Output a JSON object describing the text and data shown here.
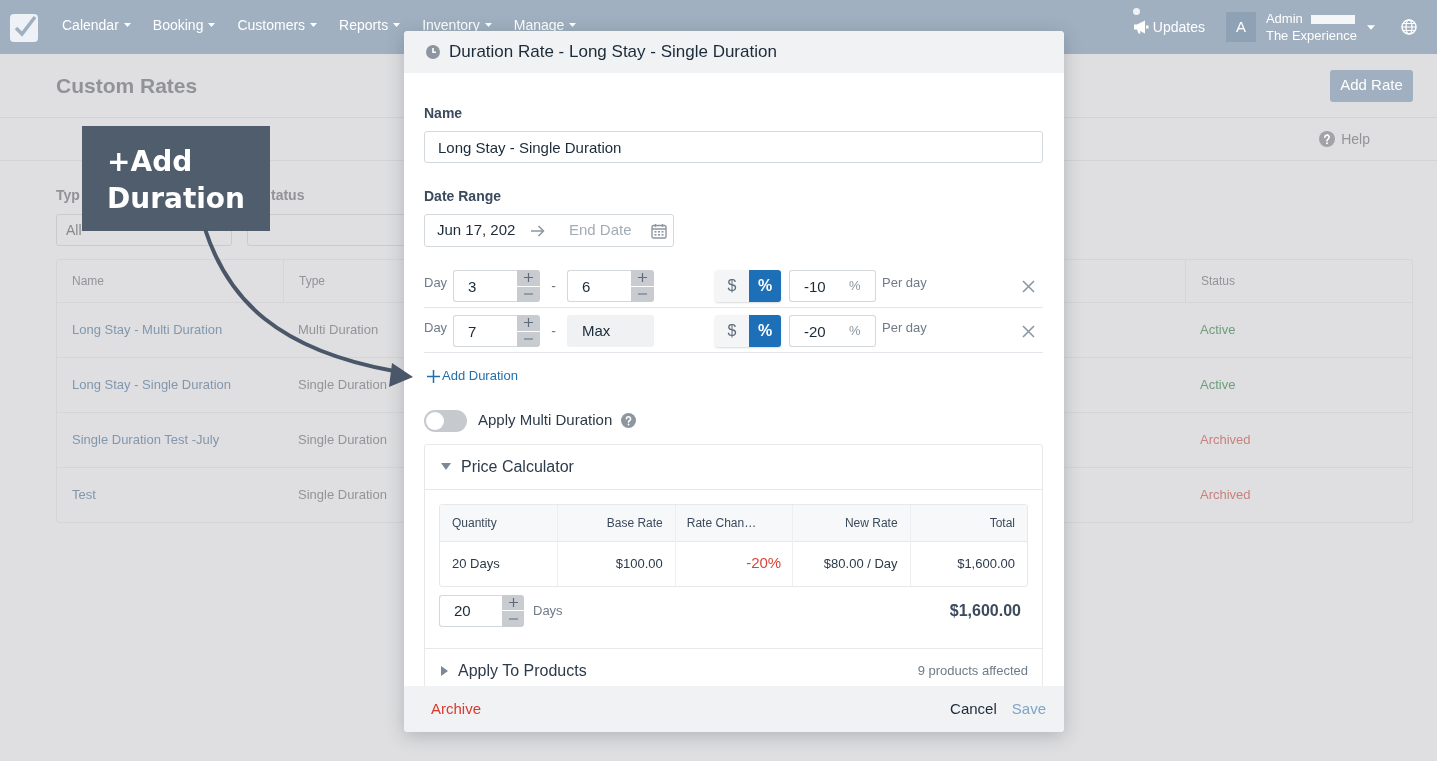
{
  "navbar": {
    "menus": [
      {
        "label": "Calendar"
      },
      {
        "label": "Booking"
      },
      {
        "label": "Customers"
      },
      {
        "label": "Reports"
      },
      {
        "label": "Inventory"
      },
      {
        "label": "Manage"
      }
    ],
    "updates": {
      "label": "Updates",
      "unread": true
    },
    "account": {
      "avatar": "A",
      "name": "Admin",
      "company": "The Experience"
    }
  },
  "page": {
    "title": "Custom Rates",
    "add_button": "Add Rate",
    "help": "Help",
    "filters": [
      {
        "label": "Typ",
        "value": "All"
      },
      {
        "label": "tatus"
      }
    ],
    "table": {
      "columns": [
        "Name",
        "Type",
        "Status"
      ],
      "rows": [
        {
          "name": "Long Stay - Multi Duration",
          "type": "Multi Duration",
          "status": {
            "label": "Active",
            "kind": "active"
          }
        },
        {
          "name": "Long Stay - Single Duration",
          "type": "Single Duration",
          "status": {
            "label": "Active",
            "kind": "active"
          }
        },
        {
          "name": "Single Duration Test -July",
          "type": "Single Duration",
          "status": {
            "label": "Archived",
            "kind": "archived"
          }
        },
        {
          "name": "Test",
          "type": "Single Duration",
          "status": {
            "label": "Archived",
            "kind": "archived"
          }
        }
      ]
    }
  },
  "annotation": {
    "text": "+Add Duration"
  },
  "modal": {
    "title": "Duration Rate - Long Stay - Single Duration",
    "name": {
      "label": "Name",
      "value": "Long Stay - Single Duration"
    },
    "date_range": {
      "label": "Date Range",
      "start": "Jun 17, 202",
      "end_placeholder": "End Date"
    },
    "durations": [
      {
        "label": "Day",
        "from": "3",
        "separator": "-",
        "end": {
          "kind": "input",
          "value": "6"
        },
        "unit_options": [
          {
            "label": "$",
            "selected": false
          },
          {
            "label": "%",
            "selected": true
          }
        ],
        "amount": "-10",
        "suffix": "%",
        "per": "Per day"
      },
      {
        "label": "Day",
        "from": "7",
        "separator": "-",
        "end": {
          "kind": "static",
          "value": "Max"
        },
        "unit_options": [
          {
            "label": "$",
            "selected": false
          },
          {
            "label": "%",
            "selected": true
          }
        ],
        "amount": "-20",
        "suffix": "%",
        "per": "Per day"
      }
    ],
    "add_duration": "Add Duration",
    "multi_duration": {
      "label": "Apply Multi Duration",
      "on": false
    },
    "price_calculator": {
      "title": "Price Calculator",
      "expanded": true,
      "columns": [
        "Quantity",
        "Base Rate",
        "Rate Chan…",
        "New Rate",
        "Total"
      ],
      "rows": [
        [
          "20 Days",
          "$100.00",
          "-20%",
          "$80.00 / Day",
          "$1,600.00"
        ]
      ],
      "quantity": "20",
      "unit": "Days",
      "total": "$1,600.00"
    },
    "apply_to_products": {
      "title": "Apply To Products",
      "expanded": false,
      "summary": "9 products affected"
    },
    "footer": {
      "archive": "Archive",
      "cancel": "Cancel",
      "save": {
        "label": "Save",
        "disabled": true
      }
    }
  }
}
